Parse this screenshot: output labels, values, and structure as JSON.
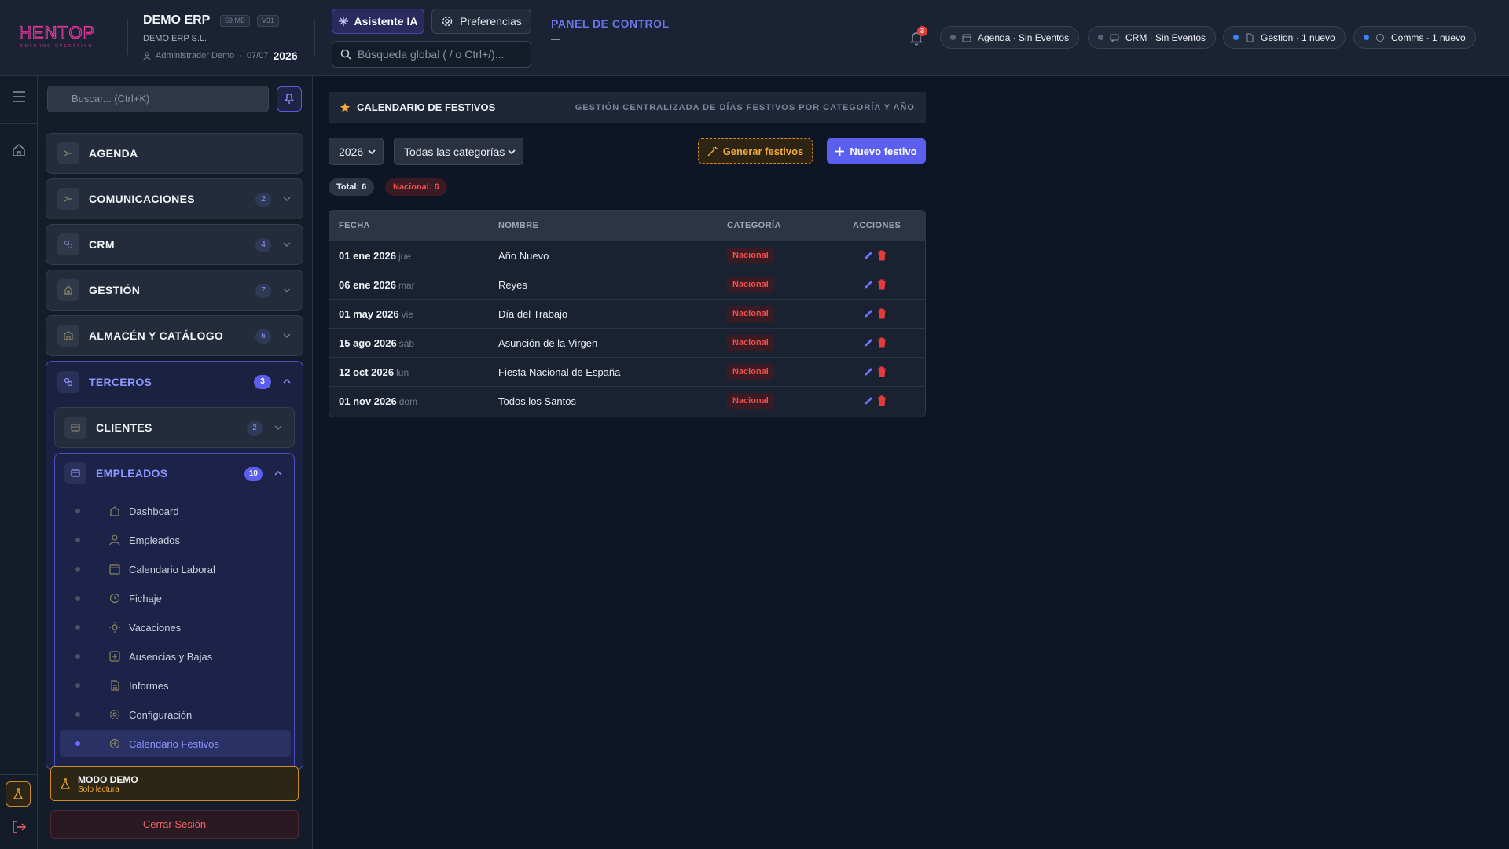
{
  "header": {
    "logo_text": "HENTOP",
    "logo_sub": "ENTORNO OPERATIVO",
    "app_name": "DEMO ERP",
    "size_chip": "59 MB",
    "version_chip": "V31",
    "company": "DEMO ERP S.L.",
    "user": "Administrador Demo",
    "date": "07/07",
    "year": "2026",
    "ai_button": "Asistente IA",
    "prefs_button": "Preferencias",
    "search_placeholder": "Búsqueda global ( / o Ctrl+/)...",
    "panel_title": "PANEL DE CONTROL",
    "notif_count": "3",
    "status_pills": [
      {
        "label": "Agenda · Sin Eventos",
        "dot": "#5a6375"
      },
      {
        "label": "CRM · Sin Eventos",
        "dot": "#5a6375"
      },
      {
        "label": "Gestion · 1 nuevo",
        "dot": "#3b82f6"
      },
      {
        "label": "Comms · 1 nuevo",
        "dot": "#3b82f6"
      }
    ]
  },
  "sidebar": {
    "search_placeholder": "Buscar... (Ctrl+K)",
    "sections": [
      {
        "label": "AGENDA",
        "count": ""
      },
      {
        "label": "COMUNICACIONES",
        "count": "2"
      },
      {
        "label": "CRM",
        "count": "4"
      },
      {
        "label": "GESTIÓN",
        "count": "7"
      },
      {
        "label": "ALMACÉN Y CATÁLOGO",
        "count": "6"
      }
    ],
    "terceros": {
      "label": "TERCEROS",
      "count": "3"
    },
    "clientes": {
      "label": "CLIENTES",
      "count": "2"
    },
    "empleados": {
      "label": "EMPLEADOS",
      "count": "10",
      "items": [
        "Dashboard",
        "Empleados",
        "Calendario Laboral",
        "Fichaje",
        "Vacaciones",
        "Ausencias y Bajas",
        "Informes",
        "Configuración",
        "Calendario Festivos"
      ],
      "active_item": "Calendario Festivos"
    },
    "demo_title": "MODO DEMO",
    "demo_sub": "Solo lectura",
    "logout": "Cerrar Sesión"
  },
  "main": {
    "title": "CALENDARIO DE FESTIVOS",
    "subtitle": "GESTIÓN CENTRALIZADA DE DÍAS FESTIVOS POR CATEGORÍA Y AÑO",
    "year_select": "2026",
    "category_select": "Todas las categorías",
    "generate_button": "Generar festivos",
    "new_button": "Nuevo festivo",
    "total_pill": "Total: 6",
    "national_pill": "Nacional: 6",
    "columns": [
      "FECHA",
      "NOMBRE",
      "CATEGORÍA",
      "ACCIONES"
    ],
    "rows": [
      {
        "date": "01 ene 2026",
        "dow": "jue",
        "name": "Año Nuevo",
        "category": "Nacional"
      },
      {
        "date": "06 ene 2026",
        "dow": "mar",
        "name": "Reyes",
        "category": "Nacional"
      },
      {
        "date": "01 may 2026",
        "dow": "vie",
        "name": "Día del Trabajo",
        "category": "Nacional"
      },
      {
        "date": "15 ago 2026",
        "dow": "sáb",
        "name": "Asunción de la Virgen",
        "category": "Nacional"
      },
      {
        "date": "12 oct 2026",
        "dow": "lun",
        "name": "Fiesta Nacional de España",
        "category": "Nacional"
      },
      {
        "date": "01 nov 2026",
        "dow": "dom",
        "name": "Todos los Santos",
        "category": "Nacional"
      }
    ]
  },
  "colors": {
    "accent": "#5b5ff0",
    "warning": "#f2a93a",
    "danger": "#ef5050",
    "logo": "#e0379a"
  }
}
